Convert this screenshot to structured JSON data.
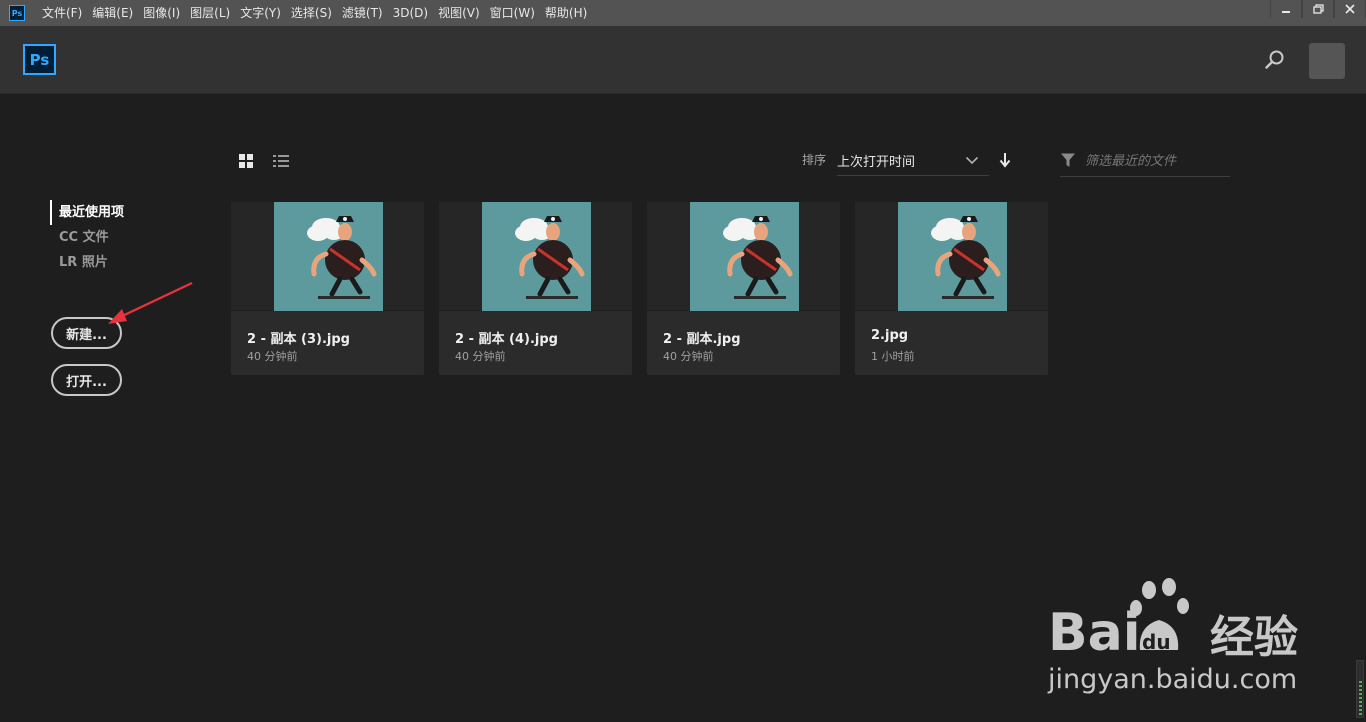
{
  "menubar": {
    "app_icon_text": "Ps",
    "items": [
      "文件(F)",
      "编辑(E)",
      "图像(I)",
      "图层(L)",
      "文字(Y)",
      "选择(S)",
      "滤镜(T)",
      "3D(D)",
      "视图(V)",
      "窗口(W)",
      "帮助(H)"
    ],
    "window_controls": [
      "minimize-icon",
      "restore-icon",
      "close-icon"
    ]
  },
  "header": {
    "logo_text": "Ps",
    "search_icon": "search-icon",
    "avatar": "avatar"
  },
  "sidebar": {
    "items": [
      {
        "label": "最近使用项",
        "active": true
      },
      {
        "label": "CC 文件",
        "active": false
      },
      {
        "label": "LR 照片",
        "active": false
      }
    ],
    "new_button": "新建...",
    "open_button": "打开..."
  },
  "toolbar": {
    "grid_view_icon": "grid-view-icon",
    "list_view_icon": "list-view-icon",
    "sort_label": "排序",
    "sort_value": "上次打开时间",
    "sort_direction_icon": "arrow-down-icon",
    "filter_icon": "filter-icon",
    "filter_placeholder": "筛选最近的文件"
  },
  "files": [
    {
      "name": "2 - 副本 (3).jpg",
      "time": "40 分钟前"
    },
    {
      "name": "2 - 副本 (4).jpg",
      "time": "40 分钟前"
    },
    {
      "name": "2 - 副本.jpg",
      "time": "40 分钟前"
    },
    {
      "name": "2.jpg",
      "time": "1 小时前"
    }
  ],
  "watermark": {
    "brand_suffix": "经验",
    "url": "jingyan.baidu.com"
  },
  "colors": {
    "accent": "#31a8ff",
    "background": "#1e1e1e",
    "annotation": "#e8323c",
    "thumbnail_bg": "#5c9a9d"
  }
}
